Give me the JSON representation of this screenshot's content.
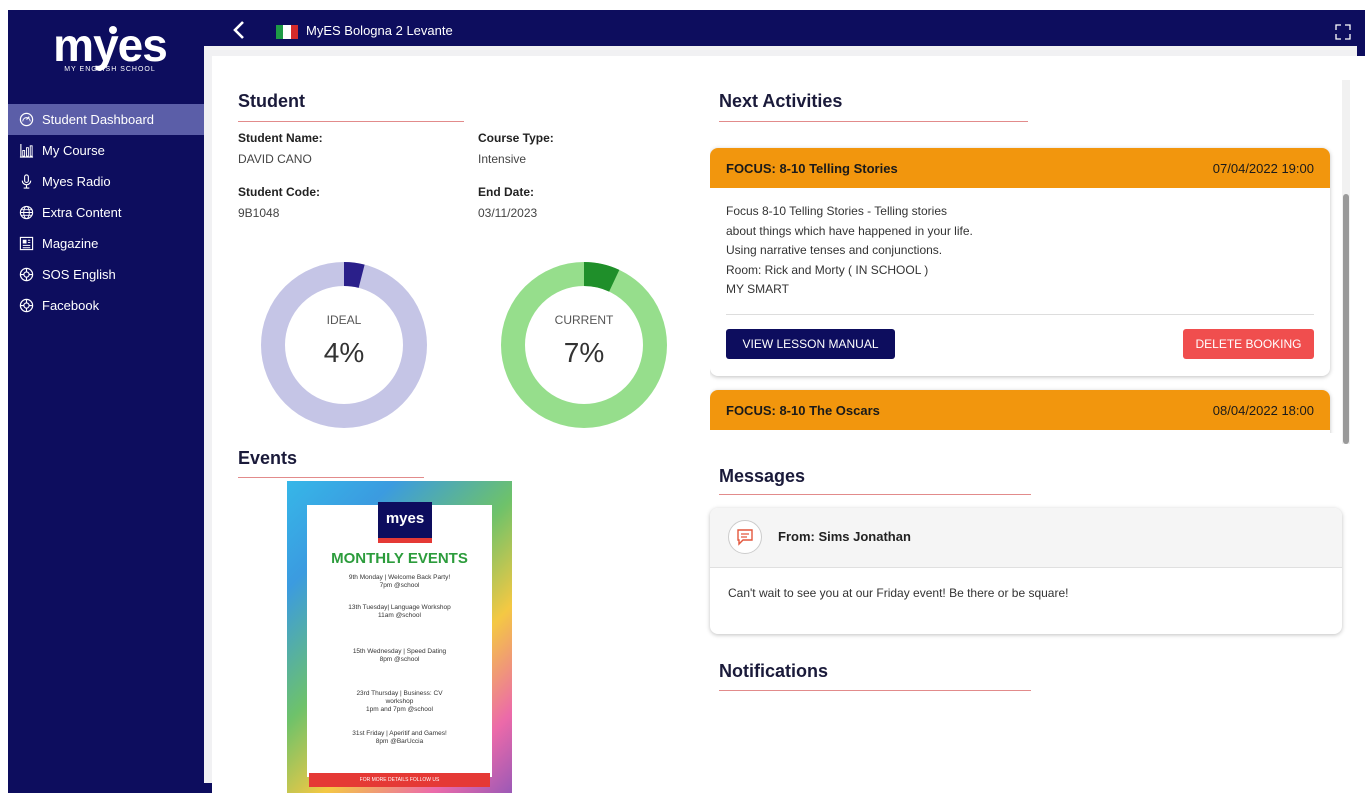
{
  "brand": {
    "logo_text": "myes",
    "logo_sub": "MY ENGLISH SCHOOL"
  },
  "sidebar": {
    "items": [
      {
        "label": "Student Dashboard",
        "icon": "dashboard-icon",
        "active": true
      },
      {
        "label": "My Course",
        "icon": "chart-icon"
      },
      {
        "label": "Myes Radio",
        "icon": "microphone-icon"
      },
      {
        "label": "Extra Content",
        "icon": "globe-icon"
      },
      {
        "label": "Magazine",
        "icon": "newspaper-icon"
      },
      {
        "label": "SOS English",
        "icon": "lifebuoy-icon"
      },
      {
        "label": "Facebook",
        "icon": "lifebuoy-icon"
      }
    ]
  },
  "topbar": {
    "center_name": "MyES Bologna 2 Levante",
    "flag": "italy-flag-icon"
  },
  "student": {
    "title": "Student",
    "name_label": "Student Name:",
    "name": "DAVID CANO",
    "course_label": "Course Type:",
    "course": "Intensive",
    "code_label": "Student Code:",
    "code": "9B1048",
    "end_label": "End Date:",
    "end": "03/11/2023"
  },
  "progress": {
    "ideal_label": "IDEAL",
    "ideal_text": "4%",
    "ideal_value": 0.04,
    "current_label": "CURRENT",
    "current_text": "7%",
    "current_value": 0.07,
    "colors": {
      "ideal_track": "#c5c5e6",
      "ideal_fill": "#2a1f8a",
      "current_track": "#96de8c",
      "current_fill": "#1f8f2a"
    }
  },
  "events": {
    "title": "Events",
    "poster": {
      "logo": "myes",
      "heading": "MONTHLY EVENTS",
      "lines": [
        "9th Monday | Welcome Back Party!",
        "7pm @school",
        "13th Tuesday| Language Workshop",
        "11am @school",
        "15th Wednesday | Speed Dating",
        "8pm @school",
        "23rd Thursday | Business: CV",
        "workshop",
        "1pm and 7pm @school",
        "31st Friday | Aperitif and Games!",
        "8pm @BarUccia"
      ],
      "footer": "FOR MORE DETAILS FOLLOW US"
    }
  },
  "activities": {
    "title": "Next Activities",
    "items": [
      {
        "title": "FOCUS: 8-10 Telling Stories",
        "datetime": "07/04/2022 19:00",
        "lines": [
          "Focus 8-10 Telling Stories - Telling stories",
          "about things which have happened in your life.",
          "Using narrative tenses and conjunctions.",
          "Room: Rick and Morty ( IN SCHOOL )",
          "MY SMART"
        ],
        "manual_label": "VIEW LESSON MANUAL",
        "delete_label": "DELETE BOOKING"
      },
      {
        "title": "FOCUS: 8-10 The Oscars",
        "datetime": "08/04/2022 18:00"
      }
    ]
  },
  "messages": {
    "title": "Messages",
    "from": "From: Sims Jonathan",
    "text": "Can't wait to see you at our Friday event! Be there or be square!"
  },
  "notifications": {
    "title": "Notifications"
  }
}
